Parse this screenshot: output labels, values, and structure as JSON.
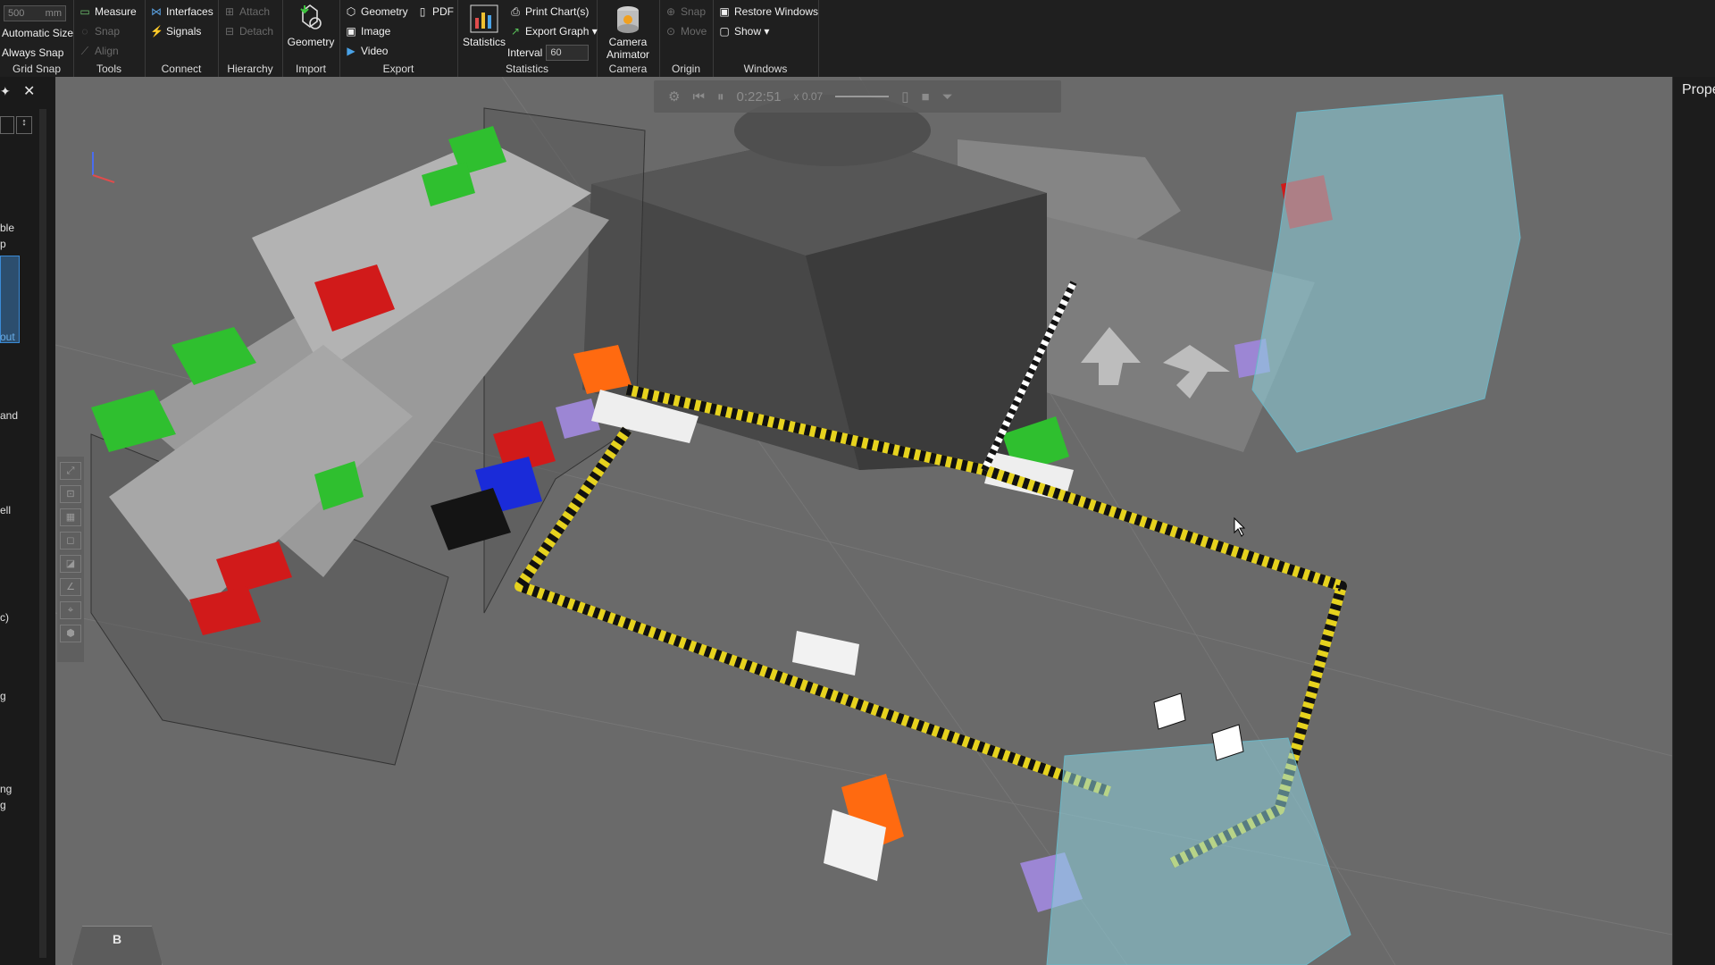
{
  "ribbon": {
    "grid_snap": {
      "value": "500",
      "unit": "mm",
      "automatic_size": "Automatic Size",
      "always_snap": "Always Snap",
      "title": "Grid Snap"
    },
    "tools": {
      "measure": "Measure",
      "snap": "Snap",
      "align": "Align",
      "title": "Tools"
    },
    "connect": {
      "interfaces": "Interfaces",
      "signals": "Signals",
      "title": "Connect"
    },
    "hierarchy": {
      "attach": "Attach",
      "detach": "Detach",
      "title": "Hierarchy"
    },
    "import": {
      "geometry": "Geometry",
      "title": "Import"
    },
    "export": {
      "geometry": "Geometry",
      "pdf": "PDF",
      "image": "Image",
      "video": "Video",
      "title": "Export"
    },
    "statistics": {
      "statistics": "Statistics",
      "print_chart": "Print Chart(s)",
      "export_graph": "Export Graph ▾",
      "interval_label": "Interval",
      "interval_value": "60",
      "title": "Statistics"
    },
    "camera": {
      "animator_line1": "Camera",
      "animator_line2": "Animator",
      "title": "Camera"
    },
    "origin": {
      "snap": "Snap",
      "move": "Move",
      "title": "Origin"
    },
    "windows": {
      "restore": "Restore Windows",
      "show": "Show ▾",
      "title": "Windows"
    }
  },
  "left_panel": {
    "items": [
      "ble",
      "p",
      "out",
      "and",
      "ell",
      "c)",
      "g",
      "ng",
      "g"
    ]
  },
  "right_panel": {
    "title": "Prope"
  },
  "viewport": {
    "playbar": {
      "time": "0:22:51",
      "speed": "x 0.07"
    },
    "view_cube_label": "B",
    "icons": [
      "settings-icon",
      "rewind-icon",
      "pause-icon",
      "slider-icon",
      "pdf-icon",
      "camera-icon",
      "filter-icon"
    ]
  },
  "colors": {
    "ribbon_bg": "#1f1f1f",
    "viewport_bg": "#6a6a6a",
    "hazard_yellow": "#e6d21e",
    "green_bin": "#2fbf2f",
    "red_bin": "#d11a1a",
    "orange_bin": "#ff6a10",
    "blue_bin": "#1a2bd9",
    "ghost_cyan": "#8fd3e0"
  }
}
